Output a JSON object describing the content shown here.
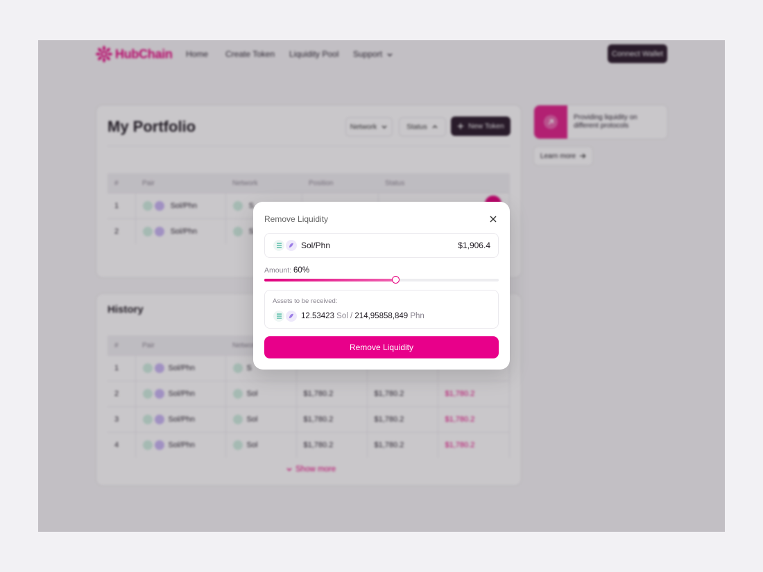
{
  "nav": {
    "brand": "HubChain",
    "links": [
      "Home",
      "Create Token",
      "Liquidity Pool",
      "Support"
    ],
    "connect": "Connect Wallet"
  },
  "portfolio": {
    "title": "My Portfolio",
    "filters": [
      "Network",
      "Status"
    ],
    "new_token": "New Token",
    "columns": [
      "#",
      "Pair",
      "Network",
      "Position",
      "Status"
    ],
    "rows": [
      {
        "n": "1",
        "pair": "Sol/Phn",
        "network": "S"
      },
      {
        "n": "2",
        "pair": "Sol/Phn",
        "network": "S"
      }
    ]
  },
  "history": {
    "title": "History",
    "columns": [
      "#",
      "Pair",
      "Network"
    ],
    "rows": [
      {
        "n": "1",
        "pair": "Sol/Phn",
        "network": "S",
        "a": "",
        "b": "",
        "c": ""
      },
      {
        "n": "2",
        "pair": "Sol/Phn",
        "network": "Sol",
        "a": "$1,780.2",
        "b": "$1,780.2",
        "c": "$1,780.2"
      },
      {
        "n": "3",
        "pair": "Sol/Phn",
        "network": "Sol",
        "a": "$1,780.2",
        "b": "$1,780.2",
        "c": "$1,780.2"
      },
      {
        "n": "4",
        "pair": "Sol/Phn",
        "network": "Sol",
        "a": "$1,780.2",
        "b": "$1,780.2",
        "c": "$1,780.2"
      }
    ],
    "show_more": "Show more"
  },
  "promo": {
    "text": "Providing liquidity on different protocols",
    "learn_more": "Learn more"
  },
  "modal": {
    "title": "Remove Liquidity",
    "pair": "Sol/Phn",
    "pair_value": "$1,906.4",
    "amount_label": "Amount:",
    "amount_value": "60%",
    "amount_fraction": 0.56,
    "assets_label": "Assets to be received:",
    "sol_amount": "12.53423",
    "sol_unit": "Sol",
    "separator": "/",
    "phn_amount": "214,95858,849",
    "phn_unit": "Phn",
    "button": "Remove Liquidity"
  },
  "colors": {
    "accent": "#e6007e",
    "dark": "#2a1a2a"
  }
}
